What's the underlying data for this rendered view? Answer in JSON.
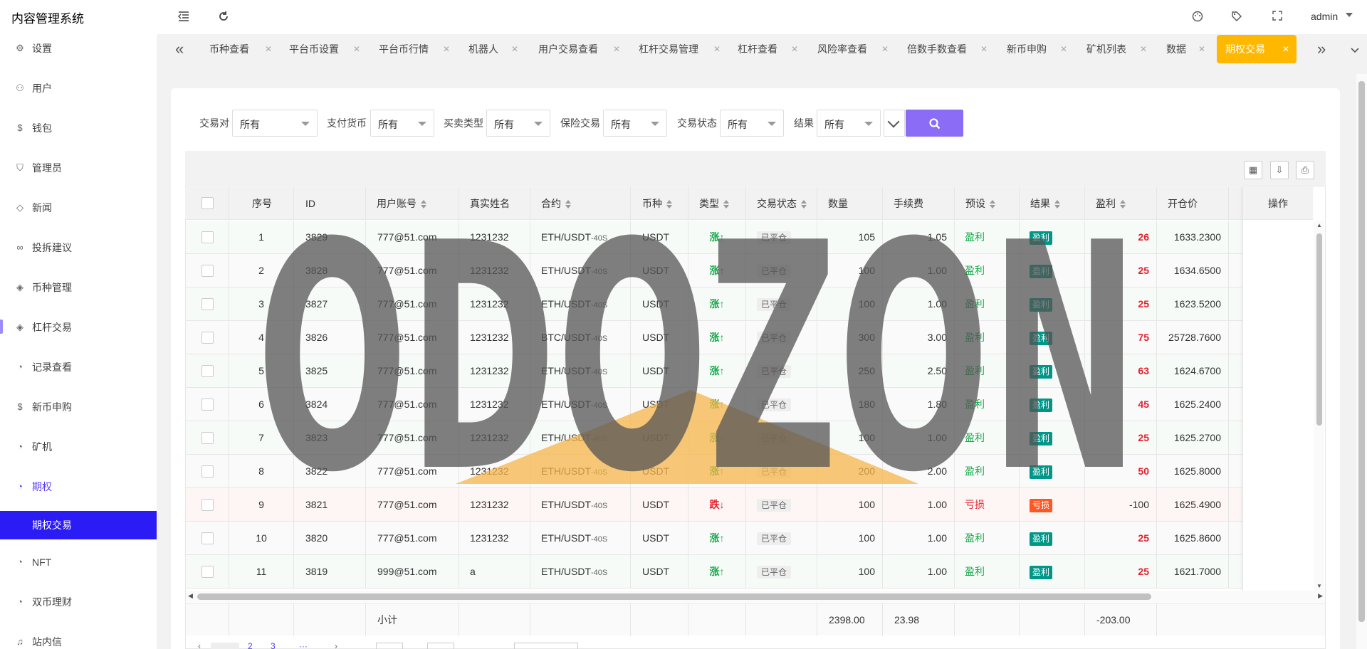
{
  "header": {
    "title": "内容管理系统",
    "user": "admin",
    "icons": [
      "menu-fold-icon",
      "refresh-icon",
      "palette-icon",
      "tag-icon",
      "fullscreen-icon"
    ]
  },
  "sidebar": {
    "items": [
      {
        "label": "设置",
        "icon": "gear-icon"
      },
      {
        "label": "用户",
        "icon": "user-icon"
      },
      {
        "label": "钱包",
        "icon": "dollar-icon"
      },
      {
        "label": "管理员",
        "icon": "shield-icon"
      },
      {
        "label": "新闻",
        "icon": "tag-icon"
      },
      {
        "label": "投拆建议",
        "icon": "link-icon"
      },
      {
        "label": "币种管理",
        "icon": "diamond-icon"
      },
      {
        "label": "杠杆交易",
        "icon": "diamond-icon"
      },
      {
        "label": "记录查看",
        "icon": "clock-icon"
      },
      {
        "label": "新币申购",
        "icon": "dollar-icon"
      },
      {
        "label": "矿机",
        "icon": "clock-icon"
      },
      {
        "label": "期权",
        "icon": "clock-icon"
      },
      {
        "label": "NFT",
        "icon": "clock-icon"
      },
      {
        "label": "双币理财",
        "icon": "clock-icon"
      },
      {
        "label": "站内信",
        "icon": "bell-icon"
      }
    ],
    "active_sub": "期权交易"
  },
  "tabs": [
    "币种查看",
    "平台币设置",
    "平台币行情",
    "机器人",
    "用户交易查看",
    "杠杆交易管理",
    "杠杆查看",
    "风险率查看",
    "倍数手数查看",
    "新币申购",
    "矿机列表",
    "数据",
    "期权交易"
  ],
  "filters": [
    {
      "label": "交易对",
      "value": "所有"
    },
    {
      "label": "支付货币",
      "value": "所有"
    },
    {
      "label": "买卖类型",
      "value": "所有"
    },
    {
      "label": "保险交易",
      "value": "所有"
    },
    {
      "label": "交易状态",
      "value": "所有"
    },
    {
      "label": "结果",
      "value": "所有"
    }
  ],
  "table": {
    "columns": [
      "序号",
      "ID",
      "用户账号",
      "真实姓名",
      "合约",
      "币种",
      "类型",
      "交易状态",
      "数量",
      "手续费",
      "预设",
      "结果",
      "盈利",
      "开仓价",
      "操作"
    ],
    "rows": [
      {
        "no": "1",
        "id": "3829",
        "account": "777@51.com",
        "name": "1231232",
        "contract": "ETH/USDT",
        "suffix": "-40S",
        "currency": "USDT",
        "type": "涨↑",
        "state": "已平仓",
        "qty": "105",
        "fee": "1.05",
        "preset": "盈利",
        "result": "盈利",
        "profit": "26",
        "open": "1633.2300"
      },
      {
        "no": "2",
        "id": "3828",
        "account": "777@51.com",
        "name": "1231232",
        "contract": "ETH/USDT",
        "suffix": "-40S",
        "currency": "USDT",
        "type": "涨↑",
        "state": "已平仓",
        "qty": "100",
        "fee": "1.00",
        "preset": "盈利",
        "result": "盈利",
        "profit": "25",
        "open": "1634.6500"
      },
      {
        "no": "3",
        "id": "3827",
        "account": "777@51.com",
        "name": "1231232",
        "contract": "ETH/USDT",
        "suffix": "-40S",
        "currency": "USDT",
        "type": "涨↑",
        "state": "已平仓",
        "qty": "100",
        "fee": "1.00",
        "preset": "盈利",
        "result": "盈利",
        "profit": "25",
        "open": "1623.5200"
      },
      {
        "no": "4",
        "id": "3826",
        "account": "777@51.com",
        "name": "1231232",
        "contract": "BTC/USDT",
        "suffix": "-40S",
        "currency": "USDT",
        "type": "涨↑",
        "state": "已平仓",
        "qty": "300",
        "fee": "3.00",
        "preset": "盈利",
        "result": "盈利",
        "profit": "75",
        "open": "25728.7600"
      },
      {
        "no": "5",
        "id": "3825",
        "account": "777@51.com",
        "name": "1231232",
        "contract": "ETH/USDT",
        "suffix": "-40S",
        "currency": "USDT",
        "type": "涨↑",
        "state": "已平仓",
        "qty": "250",
        "fee": "2.50",
        "preset": "盈利",
        "result": "盈利",
        "profit": "63",
        "open": "1624.6700"
      },
      {
        "no": "6",
        "id": "3824",
        "account": "777@51.com",
        "name": "1231232",
        "contract": "ETH/USDT",
        "suffix": "-40S",
        "currency": "USDT",
        "type": "涨↑",
        "state": "已平仓",
        "qty": "180",
        "fee": "1.80",
        "preset": "盈利",
        "result": "盈利",
        "profit": "45",
        "open": "1625.2400"
      },
      {
        "no": "7",
        "id": "3823",
        "account": "777@51.com",
        "name": "1231232",
        "contract": "ETH/USDT",
        "suffix": "-40S",
        "currency": "USDT",
        "type": "涨↑",
        "state": "已平仓",
        "qty": "100",
        "fee": "1.00",
        "preset": "盈利",
        "result": "盈利",
        "profit": "25",
        "open": "1625.2700"
      },
      {
        "no": "8",
        "id": "3822",
        "account": "777@51.com",
        "name": "1231232",
        "contract": "ETH/USDT",
        "suffix": "-40S",
        "currency": "USDT",
        "type": "涨↑",
        "state": "已平仓",
        "qty": "200",
        "fee": "2.00",
        "preset": "盈利",
        "result": "盈利",
        "profit": "50",
        "open": "1625.8000"
      },
      {
        "no": "9",
        "id": "3821",
        "account": "777@51.com",
        "name": "1231232",
        "contract": "ETH/USDT",
        "suffix": "-40S",
        "currency": "USDT",
        "type": "跌↓",
        "state": "已平仓",
        "qty": "100",
        "fee": "1.00",
        "preset": "亏损",
        "result": "亏损",
        "profit": "-100",
        "open": "1625.4900"
      },
      {
        "no": "10",
        "id": "3820",
        "account": "777@51.com",
        "name": "1231232",
        "contract": "ETH/USDT",
        "suffix": "-40S",
        "currency": "USDT",
        "type": "涨↑",
        "state": "已平仓",
        "qty": "100",
        "fee": "1.00",
        "preset": "盈利",
        "result": "盈利",
        "profit": "25",
        "open": "1625.8600"
      },
      {
        "no": "11",
        "id": "3819",
        "account": "999@51.com",
        "name": "a",
        "contract": "ETH/USDT",
        "suffix": "-40S",
        "currency": "USDT",
        "type": "涨↑",
        "state": "已平仓",
        "qty": "100",
        "fee": "1.00",
        "preset": "盈利",
        "result": "盈利",
        "profit": "25",
        "open": "1621.7000"
      }
    ],
    "totals": {
      "label": "小计",
      "qty": "2398.00",
      "fee": "23.98",
      "profit": "-203.00"
    }
  },
  "watermark": {
    "text": "ODOZON",
    "color": "#555555",
    "accent": "#f5b44a"
  },
  "colors": {
    "accent": "#2b1bf5",
    "tab_active": "#ffb800",
    "search": "#8a6cf7",
    "win": "#009688",
    "loss": "#ff5722"
  }
}
